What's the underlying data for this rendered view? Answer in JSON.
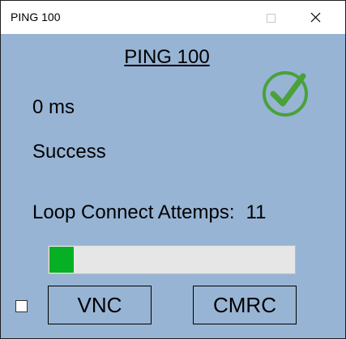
{
  "window": {
    "title": "PING 100",
    "icons": [
      "minimize-icon",
      "maximize-icon",
      "close-icon"
    ]
  },
  "main": {
    "heading": "PING 100",
    "latency": "0 ms",
    "status": "Success",
    "status_icon": "check-circle-icon",
    "loop_label": "Loop Connect Attemps:",
    "loop_count": "11",
    "progress_fraction": 0.1,
    "checkbox_checked": false,
    "buttons": {
      "vnc": "VNC",
      "cmrc": "CMRC"
    }
  },
  "colors": {
    "background": "#97b4d4",
    "progress_fill": "#06b025",
    "check": "#4aa13a"
  }
}
